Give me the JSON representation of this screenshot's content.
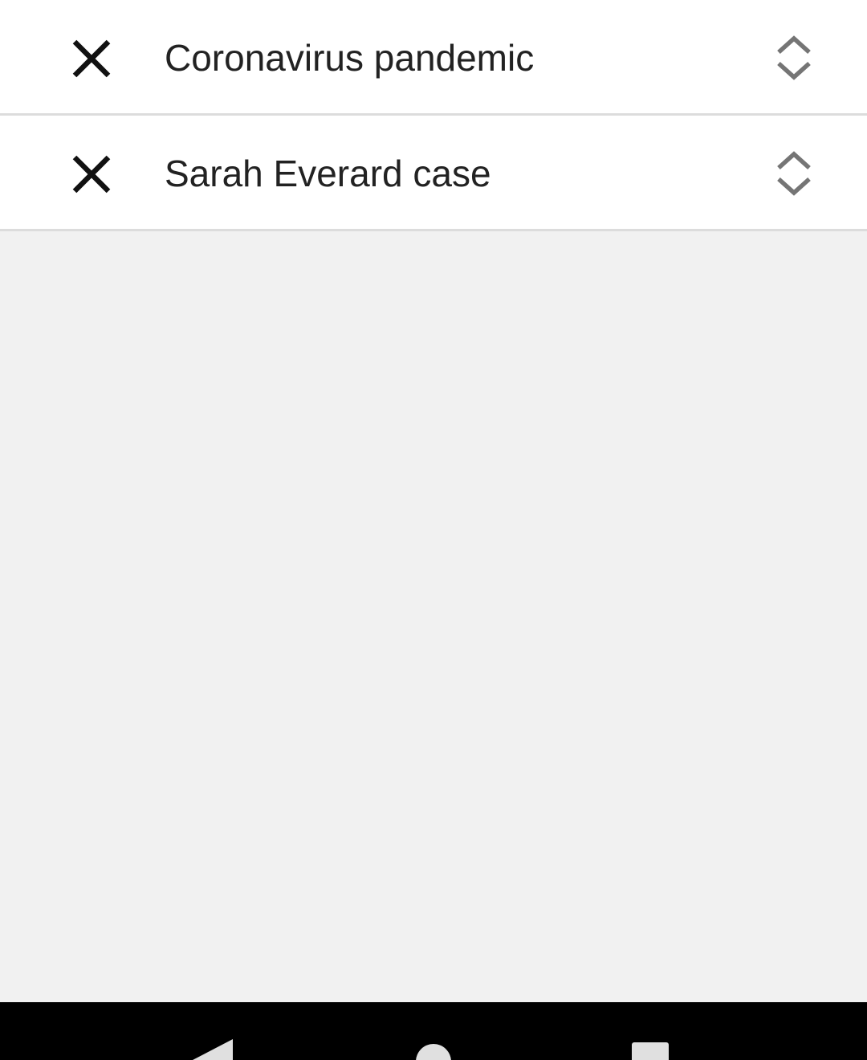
{
  "topics": [
    {
      "label": "Coronavirus pandemic",
      "remove_icon": "close-icon",
      "handle_icon": "drag-reorder-icon"
    },
    {
      "label": "Sarah Everard case",
      "remove_icon": "close-icon",
      "handle_icon": "drag-reorder-icon"
    }
  ],
  "navigation": {
    "back_icon": "back-triangle-icon",
    "home_icon": "home-circle-icon",
    "recents_icon": "recents-square-icon"
  },
  "colors": {
    "row_background": "#ffffff",
    "page_background": "#f1f1f1",
    "divider": "#dcdcdc",
    "close_icon": "#111111",
    "handle_icon": "#757575",
    "navbar": "#000000",
    "nav_icons": "#e0e0e0"
  }
}
